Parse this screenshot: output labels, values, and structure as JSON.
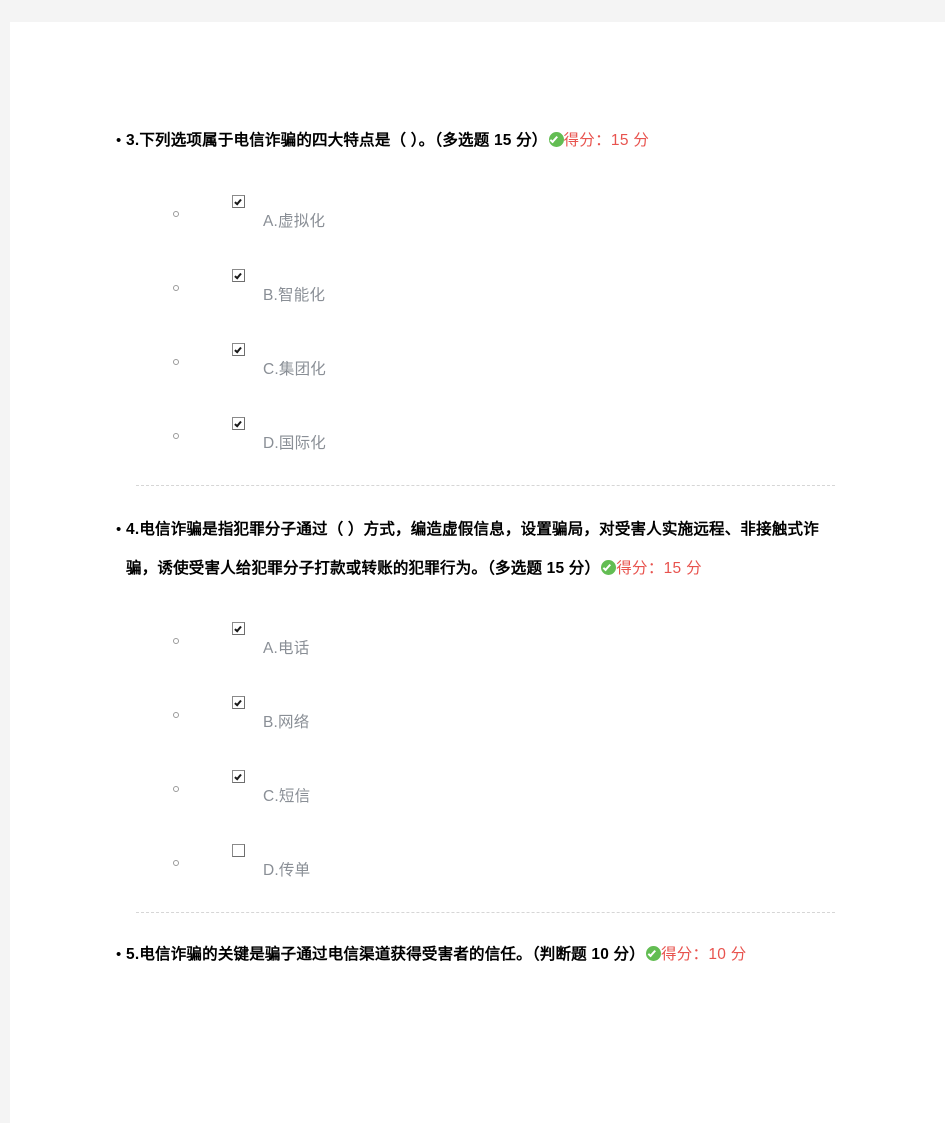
{
  "page": {
    "background_color": "#f4f4f4",
    "content_color": "#ffffff",
    "score_color": "#e8534e",
    "badge_color": "#63bd53",
    "option_text_color": "#8a8f96"
  },
  "questions": [
    {
      "bullet": "•",
      "number": "3.",
      "stem": "下列选项属于电信诈骗的四大特点是（   ）。（多选题 15 分）",
      "badge_icon": "green-check-circle-icon",
      "score_label": "得分：15 分",
      "options": [
        {
          "label": "A.虚拟化",
          "checked": true
        },
        {
          "label": "B.智能化",
          "checked": true
        },
        {
          "label": "C.集团化",
          "checked": true
        },
        {
          "label": "D.国际化",
          "checked": true
        }
      ]
    },
    {
      "bullet": "•",
      "number": "4.",
      "stem": "电信诈骗是指犯罪分子通过（  ）方式，编造虚假信息，设置骗局，对受害人实施远程、非接触式诈骗，诱使受害人给犯罪分子打款或转账的犯罪行为。（多选题 15 分）",
      "badge_icon": "green-check-circle-icon",
      "score_label": "得分：15 分",
      "options": [
        {
          "label": "A.电话",
          "checked": true
        },
        {
          "label": "B.网络",
          "checked": true
        },
        {
          "label": "C.短信",
          "checked": true
        },
        {
          "label": "D.传单",
          "checked": false
        }
      ]
    },
    {
      "bullet": "•",
      "number": "5.",
      "stem": "电信诈骗的关键是骗子通过电信渠道获得受害者的信任。（判断题 10 分）",
      "badge_icon": "green-check-circle-icon",
      "score_label": "得分：10 分",
      "options": []
    }
  ]
}
